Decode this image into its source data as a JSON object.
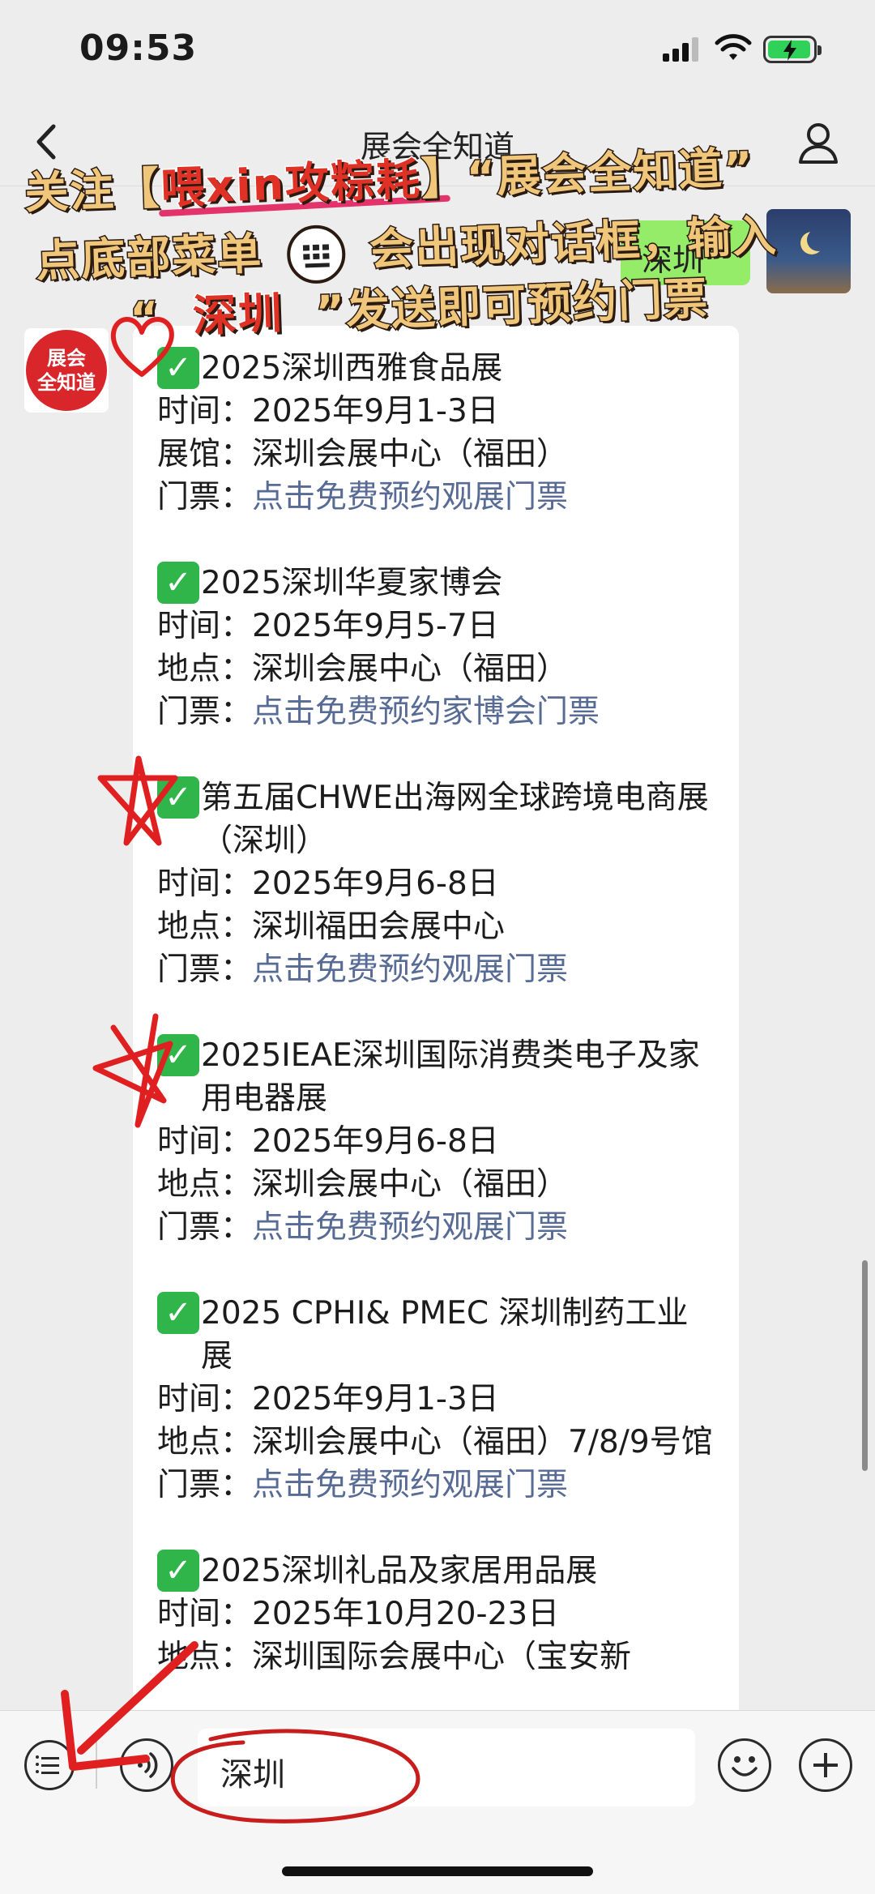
{
  "status_bar": {
    "time": "09:53"
  },
  "nav": {
    "title": "展会全知道"
  },
  "sent_message": {
    "text": "深圳"
  },
  "account_avatar": {
    "line1": "展会",
    "line2": "全知道"
  },
  "exhibitions": [
    {
      "title": "2025深圳西雅食品展",
      "rows": [
        {
          "label": "时间：",
          "value": "2025年9月1-3日"
        },
        {
          "label": "展馆：",
          "value": "深圳会展中心（福田）"
        }
      ],
      "ticket_label": "门票：",
      "ticket_link": "点击免费预约观展门票"
    },
    {
      "title": "2025深圳华夏家博会",
      "rows": [
        {
          "label": "时间：",
          "value": "2025年9月5-7日"
        },
        {
          "label": "地点：",
          "value": "深圳会展中心（福田）"
        }
      ],
      "ticket_label": "门票：",
      "ticket_link": "点击免费预约家博会门票"
    },
    {
      "title": "第五届CHWE出海网全球跨境电商展（深圳）",
      "rows": [
        {
          "label": "时间：",
          "value": "2025年9月6-8日"
        },
        {
          "label": "地点：",
          "value": "深圳福田会展中心"
        }
      ],
      "ticket_label": "门票：",
      "ticket_link": "点击免费预约观展门票"
    },
    {
      "title": "2025IEAE深圳国际消费类电子及家用电器展",
      "rows": [
        {
          "label": "时间：",
          "value": "2025年9月6-8日"
        },
        {
          "label": "地点：",
          "value": "深圳会展中心（福田）"
        }
      ],
      "ticket_label": "门票：",
      "ticket_link": "点击免费预约观展门票"
    },
    {
      "title": "2025 CPHI& PMEC 深圳制药工业展",
      "rows": [
        {
          "label": "时间：",
          "value": "2025年9月1-3日"
        },
        {
          "label": "地点：",
          "value": "深圳会展中心（福田）7/8/9号馆"
        }
      ],
      "ticket_label": "门票：",
      "ticket_link": "点击免费预约观展门票"
    },
    {
      "title": "2025深圳礼品及家居用品展",
      "rows": [
        {
          "label": "时间：",
          "value": "2025年10月20-23日"
        },
        {
          "label": "地点：",
          "value": "深圳国际会展中心（宝安新"
        }
      ],
      "ticket_label": "",
      "ticket_link": ""
    }
  ],
  "input": {
    "value": "深圳"
  },
  "promo": {
    "line1_a": "关注【",
    "line1_b": "喂xin攻粽耗",
    "line1_c": "】“展会全知道”",
    "line2_a": "点底部菜单",
    "line2_b": "会出现对话框，输入",
    "line3_a": "“",
    "line3_b": "深圳",
    "line3_c": "”发送即可预约门票"
  },
  "colors": {
    "chat_bg": "#ededed",
    "sent_bubble": "#95ec69",
    "link": "#576b95",
    "check": "#2fb54a",
    "promo_text": "#f0c77a",
    "annotation_red": "#e02020"
  }
}
